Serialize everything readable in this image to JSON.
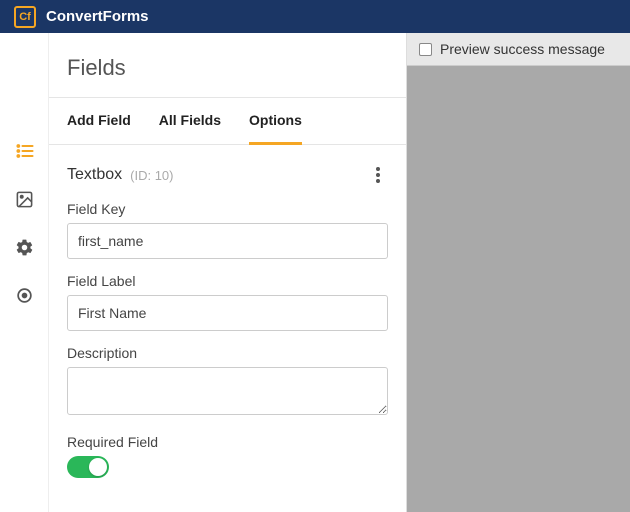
{
  "app": {
    "logo_short": "Cf",
    "title": "ConvertForms"
  },
  "panel": {
    "title": "Fields"
  },
  "tabs": {
    "add_field": "Add Field",
    "all_fields": "All Fields",
    "options": "Options"
  },
  "field": {
    "type_label": "Textbox",
    "id_label": "(ID: 10)",
    "key_label": "Field Key",
    "key_value": "first_name",
    "label_label": "Field Label",
    "label_value": "First Name",
    "description_label": "Description",
    "description_value": "",
    "required_label": "Required Field"
  },
  "preview": {
    "success_checkbox_label": "Preview success message"
  }
}
